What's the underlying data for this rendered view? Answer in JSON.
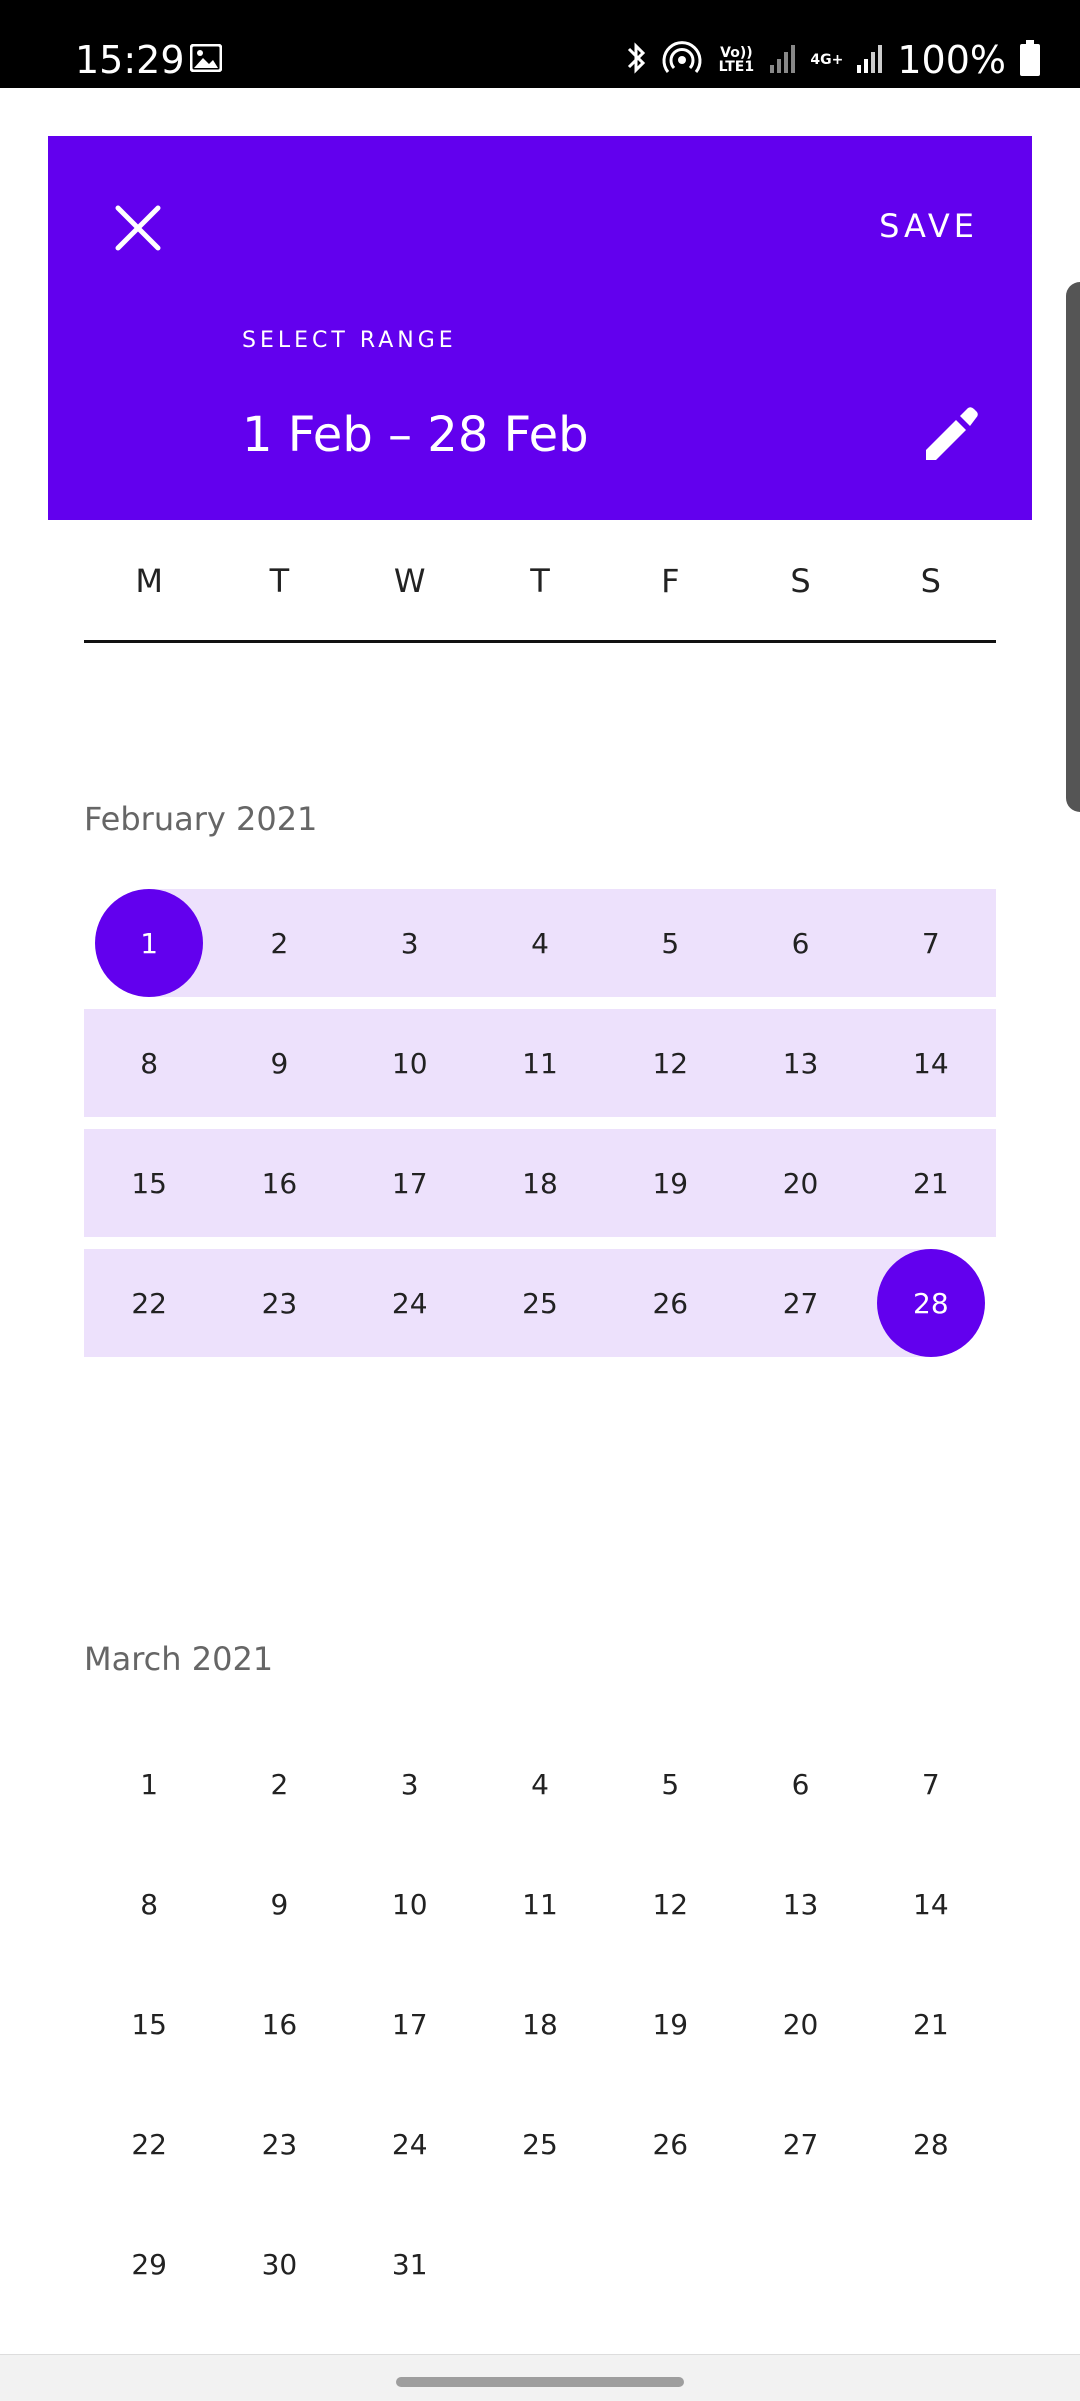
{
  "status_bar": {
    "time": "15:29",
    "battery_percent": "100%",
    "lte_label": "Vo)) LTE1",
    "network_label": "4G+"
  },
  "header": {
    "save_label": "SAVE",
    "select_range_label": "SELECT RANGE",
    "range_text": "1 Feb – 28 Feb",
    "accent_color": "#6200EE"
  },
  "weekdays": [
    "M",
    "T",
    "W",
    "T",
    "F",
    "S",
    "S"
  ],
  "months": [
    {
      "title": "February 2021",
      "weeks": [
        [
          "1",
          "2",
          "3",
          "4",
          "5",
          "6",
          "7"
        ],
        [
          "8",
          "9",
          "10",
          "11",
          "12",
          "13",
          "14"
        ],
        [
          "15",
          "16",
          "17",
          "18",
          "19",
          "20",
          "21"
        ],
        [
          "22",
          "23",
          "24",
          "25",
          "26",
          "27",
          "28"
        ]
      ],
      "selected_start": "1",
      "selected_end": "28"
    },
    {
      "title": "March 2021",
      "weeks": [
        [
          "1",
          "2",
          "3",
          "4",
          "5",
          "6",
          "7"
        ],
        [
          "8",
          "9",
          "10",
          "11",
          "12",
          "13",
          "14"
        ],
        [
          "15",
          "16",
          "17",
          "18",
          "19",
          "20",
          "21"
        ],
        [
          "22",
          "23",
          "24",
          "25",
          "26",
          "27",
          "28"
        ],
        [
          "29",
          "30",
          "31",
          "",
          "",
          "",
          ""
        ]
      ]
    }
  ]
}
